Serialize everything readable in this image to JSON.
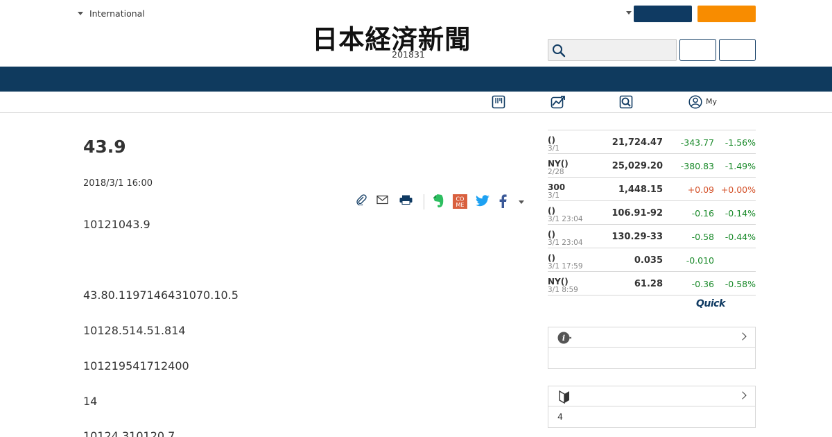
{
  "header": {
    "edition_label": "International",
    "logo_text": "日本経済新聞",
    "date_text": "201831"
  },
  "subnav": {
    "my_label": "My"
  },
  "article": {
    "title": "43.9",
    "date": "2018/3/1 16:00",
    "paragraphs": [
      "10121043.9",
      "43.80.1197146431070.10.5",
      "10128.514.51.814",
      "101219541712400",
      "14",
      "10124.310120.7"
    ]
  },
  "market": {
    "rows": [
      {
        "name": "()",
        "time": "3/1",
        "value": "21,724.47",
        "change": "-343.77",
        "pct": "-1.56%",
        "dir": "neg"
      },
      {
        "name": "NY()",
        "time": "2/28",
        "value": "25,029.20",
        "change": "-380.83",
        "pct": "-1.49%",
        "dir": "neg"
      },
      {
        "name": "300",
        "time": "3/1",
        "value": "1,448.15",
        "change": "+0.09",
        "pct": "+0.00%",
        "dir": "pos"
      },
      {
        "name": "()",
        "time": "3/1 23:04",
        "value": "106.91-92",
        "change": "-0.16",
        "pct": "-0.14%",
        "dir": "neg"
      },
      {
        "name": "()",
        "time": "3/1 23:04",
        "value": "130.29-33",
        "change": "-0.58",
        "pct": "-0.44%",
        "dir": "neg"
      },
      {
        "name": "()",
        "time": "3/1 17:59",
        "value": "0.035",
        "change": "-0.010",
        "pct": "",
        "dir": "neg"
      },
      {
        "name": "NY()",
        "time": "3/1 8:59",
        "value": "61.28",
        "change": "-0.36",
        "pct": "-0.58%",
        "dir": "neg"
      }
    ],
    "source_logo": "Quick"
  },
  "boxes": {
    "info_body": "",
    "beginner_body": "4"
  },
  "colors": {
    "navy": "#0f3a5e",
    "orange": "#f88c00",
    "negative": "#1a8a2a",
    "positive": "#d4522a"
  },
  "icons": {
    "share": [
      "clip-icon",
      "mail-icon",
      "print-icon",
      "evernote-icon",
      "comemo-icon",
      "twitter-icon",
      "facebook-icon",
      "more-dropdown-icon"
    ],
    "subnav": [
      "newspaper-icon",
      "chart-icon",
      "search-icon",
      "user-icon"
    ]
  }
}
